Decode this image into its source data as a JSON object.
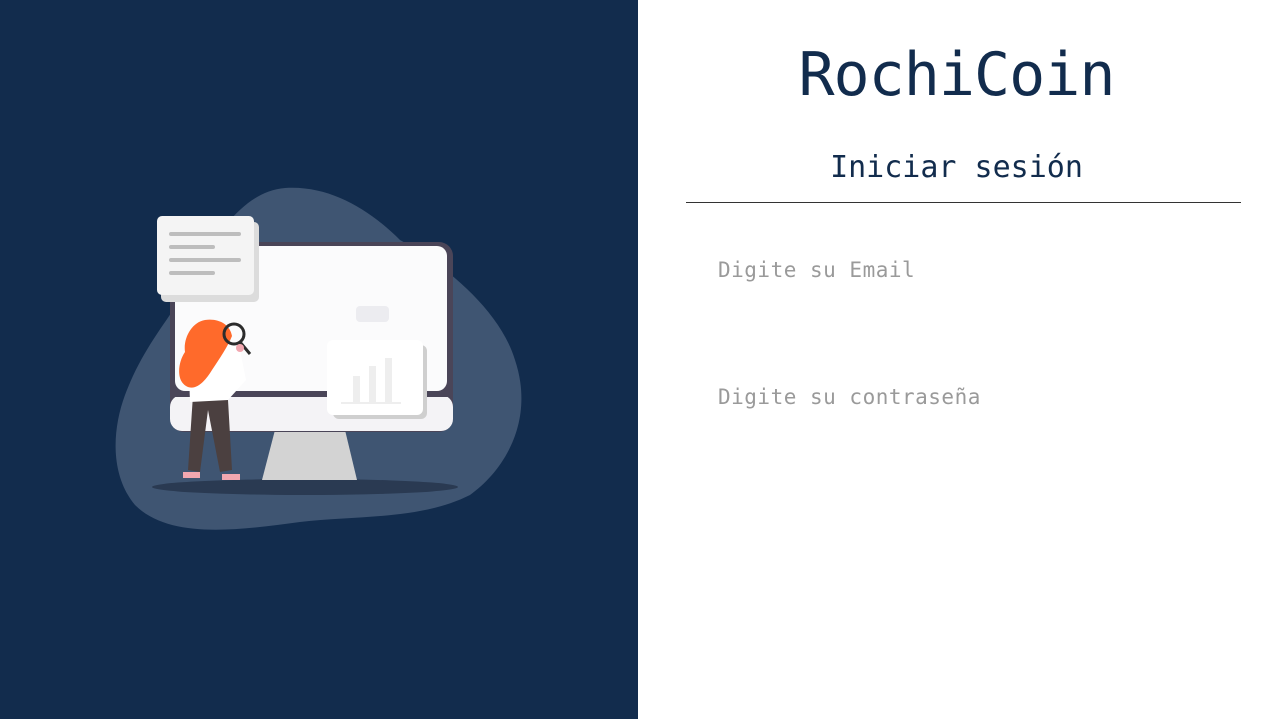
{
  "app": {
    "title": "RochiCoin"
  },
  "login": {
    "heading": "Iniciar sesión",
    "email_placeholder": "Digite su Email",
    "password_placeholder": "Digite su contraseña"
  },
  "colors": {
    "panel_bg": "#122c4d",
    "blob": "#3f5572",
    "accent_hair": "#ff6a2b",
    "text_primary": "#122c4d"
  },
  "illustration": {
    "icon": "person-at-computer-illustration"
  }
}
